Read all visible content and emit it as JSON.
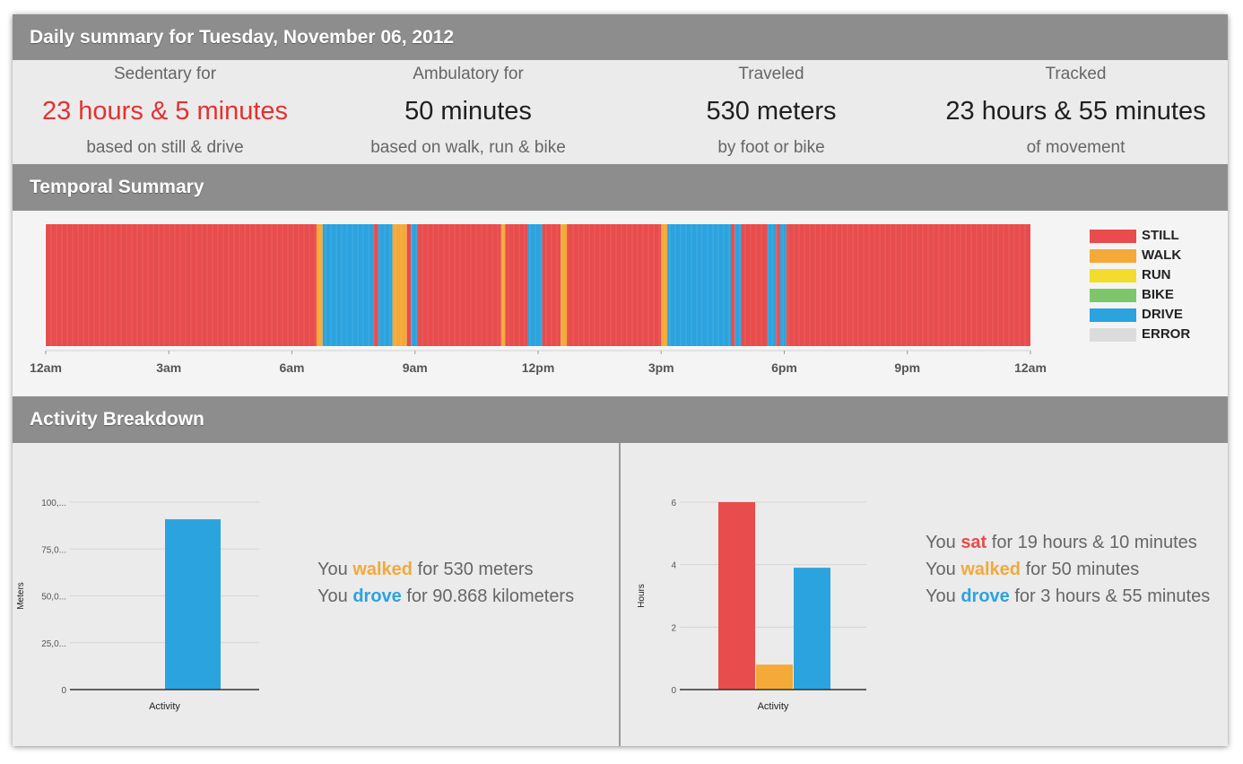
{
  "header": {
    "daily_title": "Daily summary for Tuesday, November 06, 2012"
  },
  "stats": [
    {
      "label": "Sedentary for",
      "value": "23 hours & 5 minutes",
      "sub": "based on still & drive"
    },
    {
      "label": "Ambulatory for",
      "value": "50 minutes",
      "sub": "based on walk, run & bike"
    },
    {
      "label": "Traveled",
      "value": "530 meters",
      "sub": "by foot or bike"
    },
    {
      "label": "Tracked",
      "value": "23 hours & 55 minutes",
      "sub": "of movement"
    }
  ],
  "temporal": {
    "title": "Temporal Summary",
    "axis_labels": [
      "12am",
      "3am",
      "6am",
      "9am",
      "12pm",
      "3pm",
      "6pm",
      "9pm",
      "12am"
    ],
    "segments": [
      {
        "start_h": 0.0,
        "end_h": 6.6,
        "type": "STILL"
      },
      {
        "start_h": 6.6,
        "end_h": 6.75,
        "type": "WALK"
      },
      {
        "start_h": 6.75,
        "end_h": 8.0,
        "type": "DRIVE"
      },
      {
        "start_h": 8.0,
        "end_h": 8.1,
        "type": "STILL"
      },
      {
        "start_h": 8.1,
        "end_h": 8.45,
        "type": "DRIVE"
      },
      {
        "start_h": 8.45,
        "end_h": 8.8,
        "type": "WALK"
      },
      {
        "start_h": 8.8,
        "end_h": 8.9,
        "type": "STILL"
      },
      {
        "start_h": 8.9,
        "end_h": 9.05,
        "type": "DRIVE"
      },
      {
        "start_h": 9.05,
        "end_h": 11.1,
        "type": "STILL"
      },
      {
        "start_h": 11.1,
        "end_h": 11.2,
        "type": "WALK"
      },
      {
        "start_h": 11.2,
        "end_h": 11.75,
        "type": "STILL"
      },
      {
        "start_h": 11.75,
        "end_h": 12.1,
        "type": "DRIVE"
      },
      {
        "start_h": 12.1,
        "end_h": 12.55,
        "type": "STILL"
      },
      {
        "start_h": 12.55,
        "end_h": 12.7,
        "type": "WALK"
      },
      {
        "start_h": 12.7,
        "end_h": 15.0,
        "type": "STILL"
      },
      {
        "start_h": 15.0,
        "end_h": 15.15,
        "type": "WALK"
      },
      {
        "start_h": 15.15,
        "end_h": 16.7,
        "type": "DRIVE"
      },
      {
        "start_h": 16.7,
        "end_h": 16.8,
        "type": "STILL"
      },
      {
        "start_h": 16.8,
        "end_h": 16.95,
        "type": "DRIVE"
      },
      {
        "start_h": 16.95,
        "end_h": 17.6,
        "type": "STILL"
      },
      {
        "start_h": 17.6,
        "end_h": 17.8,
        "type": "DRIVE"
      },
      {
        "start_h": 17.8,
        "end_h": 17.9,
        "type": "STILL"
      },
      {
        "start_h": 17.9,
        "end_h": 18.05,
        "type": "DRIVE"
      },
      {
        "start_h": 18.05,
        "end_h": 24.0,
        "type": "STILL"
      }
    ],
    "legend": [
      {
        "label": "STILL",
        "color": "#e84c4c"
      },
      {
        "label": "WALK",
        "color": "#f4a938"
      },
      {
        "label": "RUN",
        "color": "#f2dc2c"
      },
      {
        "label": "BIKE",
        "color": "#7dc66a"
      },
      {
        "label": "DRIVE",
        "color": "#2ba3de"
      },
      {
        "label": "ERROR",
        "color": "#dcdcdc"
      }
    ]
  },
  "activity": {
    "title": "Activity Breakdown",
    "left_text": {
      "l1_a": "You ",
      "l1_kw": "walked",
      "l1_b": " for 530 meters",
      "l2_a": "You ",
      "l2_kw": "drove",
      "l2_b": " for 90.868 kilometers"
    },
    "right_text": {
      "l1_a": "You ",
      "l1_kw": "sat",
      "l1_b": " for 19 hours & 10 minutes",
      "l2_a": "You ",
      "l2_kw": "walked",
      "l2_b": " for 50 minutes",
      "l3_a": "You ",
      "l3_kw": "drove",
      "l3_b": " for 3 hours & 55 minutes"
    }
  },
  "chart_data": [
    {
      "type": "bar",
      "xlabel": "Activity",
      "ylabel": "Meters",
      "yticks": [
        "0",
        "25,0...",
        "50,0...",
        "75,0...",
        "100,..."
      ],
      "ylim": [
        0,
        100000
      ],
      "grid": true,
      "series": [
        {
          "name": "DRIVE",
          "values": [
            90868
          ],
          "color": "#2ba3de"
        }
      ]
    },
    {
      "type": "bar",
      "xlabel": "Activity",
      "ylabel": "Hours",
      "yticks": [
        "0",
        "2",
        "4",
        "6"
      ],
      "ylim": [
        0,
        6
      ],
      "grid": true,
      "series": [
        {
          "name": "STILL",
          "values": [
            6
          ],
          "color": "#e84c4c"
        },
        {
          "name": "WALK",
          "values": [
            0.8
          ],
          "color": "#f4a938"
        },
        {
          "name": "DRIVE",
          "values": [
            3.9
          ],
          "color": "#2ba3de"
        }
      ]
    }
  ]
}
